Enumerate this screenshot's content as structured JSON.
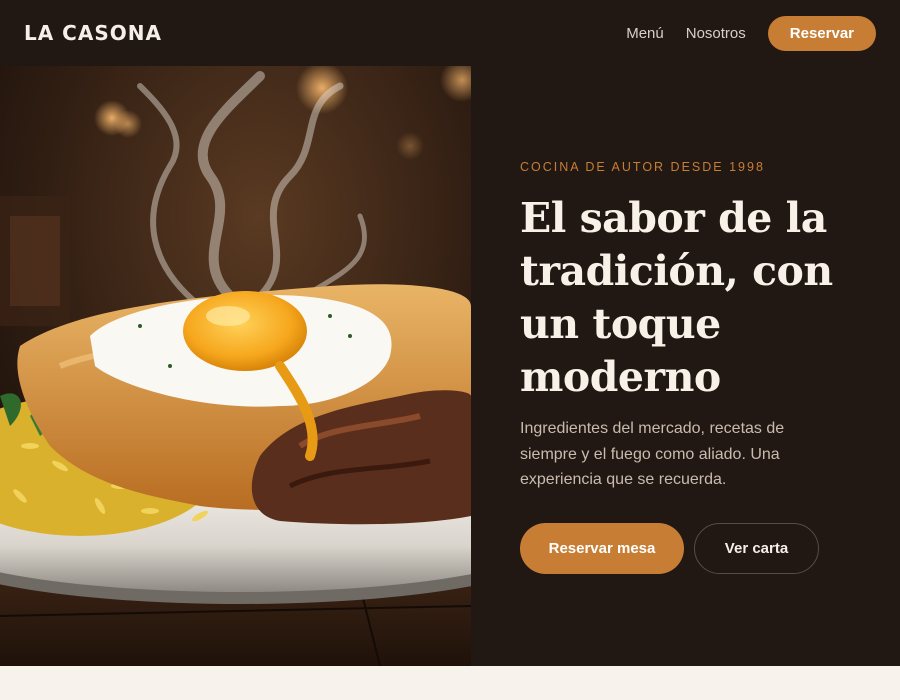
{
  "nav": {
    "brand": "LA CASONA",
    "links": [
      "Menú",
      "Nosotros"
    ],
    "cta": "Reservar"
  },
  "hero": {
    "eyebrow": "COCINA DE AUTOR DESDE 1998",
    "headline": "El sabor de la tradición, con un toque moderno",
    "lede": "Ingredientes del mercado, recetas de siempre y el fuego como aliado. Una experiencia que se recuerda.",
    "primary_button": "Reservar mesa",
    "secondary_button": "Ver carta",
    "image_subject": "steaming-plate-rice-fried-egg-beef"
  },
  "colors": {
    "dark_background": "#211814",
    "accent": "#c87d34",
    "cream": "#f7f2ec",
    "headline_text": "#f8f1e8",
    "body_text": "#c9bcae"
  }
}
